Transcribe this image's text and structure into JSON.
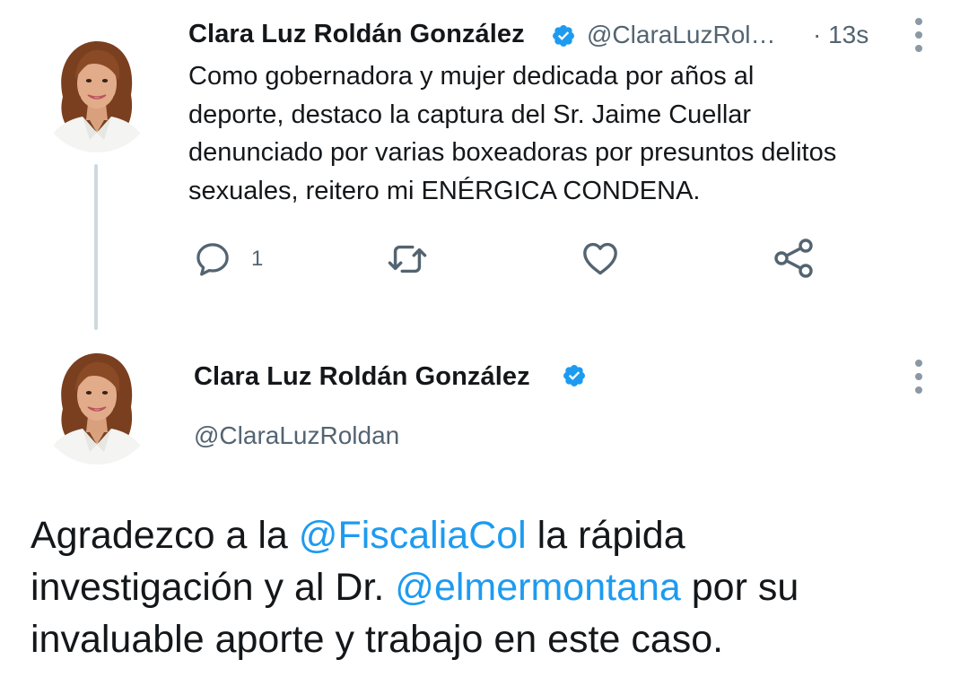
{
  "colors": {
    "text": "#14171a",
    "secondary": "#536471",
    "link": "#1d9bf0",
    "verified": "#1d9bf0",
    "thread_line": "#cfd9de"
  },
  "tweet1": {
    "display_name": "Clara Luz Roldán González",
    "handle": "@ClaraLuzRol…",
    "time": "· 13s",
    "text_lines": [
      "Como gobernadora y mujer dedicada por años al",
      "deporte,  destaco la captura del Sr. Jaime Cuellar",
      "denunciado por varias boxeadoras por presuntos delitos",
      "sexuales, reitero mi ENÉRGICA CONDENA."
    ],
    "actions": {
      "reply_icon": "reply-icon",
      "reply_count": "1",
      "retweet_icon": "retweet-icon",
      "like_icon": "heart-icon",
      "share_icon": "share-icon"
    }
  },
  "tweet2": {
    "display_name": "Clara Luz Roldán González",
    "handle": "@ClaraLuzRoldan",
    "body": {
      "line1_pre": "Agradezco a la ",
      "line1_mention": "@FiscaliaCol",
      "line1_post": " la rápida",
      "line2_pre": "investigación y al Dr. ",
      "line2_mention": "@elmermontana",
      "line2_post": " por su",
      "line3": "invaluable aporte y trabajo en este caso."
    }
  }
}
